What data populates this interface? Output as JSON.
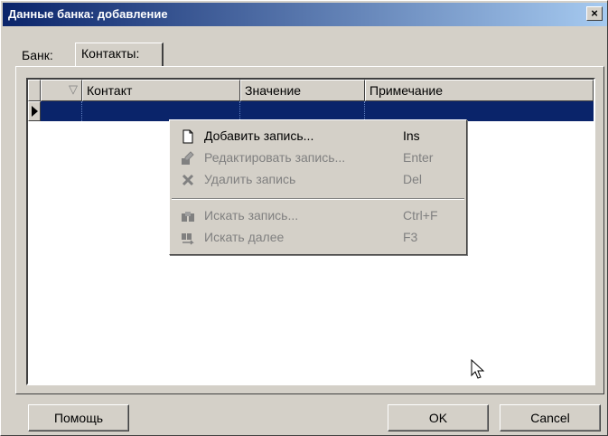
{
  "window": {
    "title": "Данные банка: добавление",
    "close_label": "×"
  },
  "tabs": [
    {
      "label": "Банк:"
    },
    {
      "label": "Контакты:"
    }
  ],
  "grid": {
    "columns": [
      {
        "label": ""
      },
      {
        "label": "Контакт"
      },
      {
        "label": "Значение"
      },
      {
        "label": "Примечание"
      }
    ]
  },
  "context_menu": {
    "items": [
      {
        "label": "Добавить запись...",
        "shortcut": "Ins",
        "icon": "new-document-icon",
        "enabled": true
      },
      {
        "label": "Редактировать запись...",
        "shortcut": "Enter",
        "icon": "edit-icon",
        "enabled": false
      },
      {
        "label": "Удалить запись",
        "shortcut": "Del",
        "icon": "delete-icon",
        "enabled": false
      },
      {
        "label": "Искать запись...",
        "shortcut": "Ctrl+F",
        "icon": "binoculars-icon",
        "enabled": false
      },
      {
        "label": "Искать далее",
        "shortcut": "F3",
        "icon": "find-next-icon",
        "enabled": false
      }
    ]
  },
  "buttons": {
    "help": "Помощь",
    "ok": "OK",
    "cancel": "Cancel"
  },
  "colors": {
    "title_gradient_start": "#0a246a",
    "title_gradient_end": "#a6caf0",
    "selection": "#0a246a",
    "face": "#d4d0c8"
  }
}
